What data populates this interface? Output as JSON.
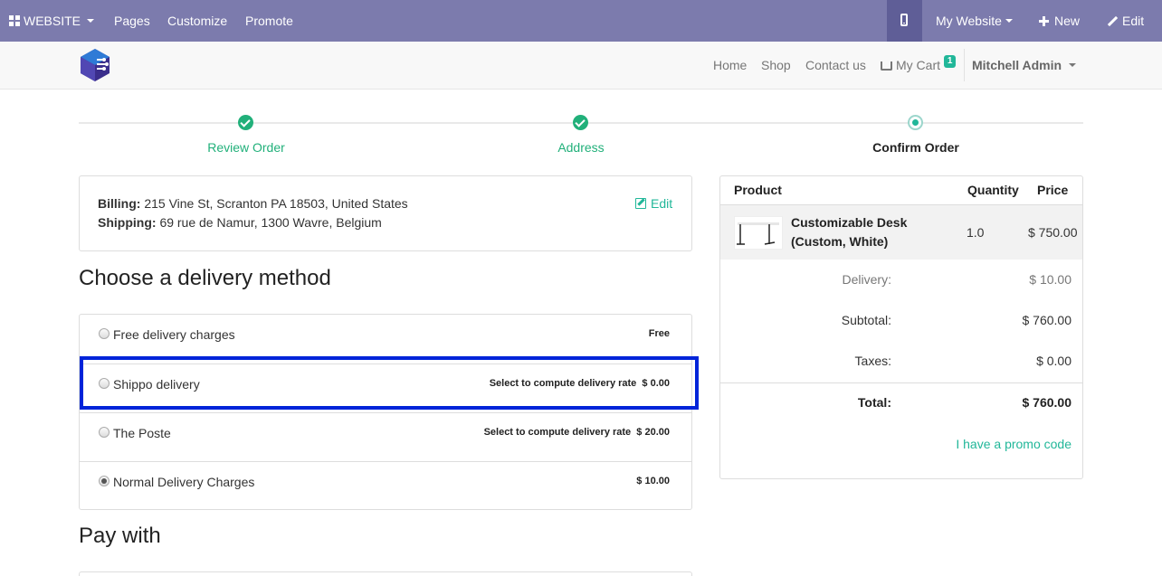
{
  "adminbar": {
    "website_label": "WEBSITE",
    "pages": "Pages",
    "customize": "Customize",
    "promote": "Promote",
    "my_website": "My Website",
    "new": "New",
    "edit": "Edit"
  },
  "navbar": {
    "home": "Home",
    "shop": "Shop",
    "contact": "Contact us",
    "cart": "My Cart",
    "cart_count": "1",
    "user": "Mitchell Admin"
  },
  "steps": [
    {
      "label": "Review Order",
      "state": "done"
    },
    {
      "label": "Address",
      "state": "done"
    },
    {
      "label": "Confirm Order",
      "state": "current"
    }
  ],
  "address": {
    "billing_label": "Billing:",
    "billing": "215 Vine St, Scranton PA 18503, United States",
    "shipping_label": "Shipping:",
    "shipping": "69 rue de Namur, 1300 Wavre, Belgium",
    "edit": "Edit"
  },
  "delivery": {
    "heading": "Choose a delivery method",
    "methods": [
      {
        "name": "Free delivery charges",
        "price": "Free",
        "selected": false
      },
      {
        "name": "Shippo delivery",
        "price": "Select to compute delivery rate  $ 0.00",
        "selected": false
      },
      {
        "name": "The Poste",
        "price": "Select to compute delivery rate  $ 20.00",
        "selected": false
      },
      {
        "name": "Normal Delivery Charges",
        "price": "$ 10.00",
        "selected": true
      }
    ]
  },
  "pay_heading": "Pay with",
  "summary": {
    "col_product": "Product",
    "col_quantity": "Quantity",
    "col_price": "Price",
    "item_name": "Customizable Desk (Custom, White)",
    "item_qty": "1.0",
    "item_price": "$ 750.00",
    "delivery_label": "Delivery:",
    "delivery_value": "$ 10.00",
    "subtotal_label": "Subtotal:",
    "subtotal_value": "$ 760.00",
    "taxes_label": "Taxes:",
    "taxes_value": "$ 0.00",
    "total_label": "Total:",
    "total_value": "$ 760.00",
    "promo": "I have a promo code"
  },
  "colors": {
    "adminbar": "#7C7BAD",
    "accent": "#21B799",
    "done_green": "#21B07A",
    "highlight_blue": "#0024D9"
  }
}
